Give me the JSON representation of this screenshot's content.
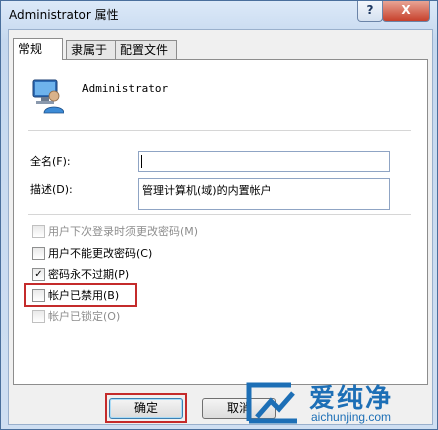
{
  "window": {
    "title": "Administrator 属性",
    "help_label": "?",
    "close_label": "X"
  },
  "tabs": [
    {
      "label": "常规"
    },
    {
      "label": "隶属于"
    },
    {
      "label": "配置文件"
    }
  ],
  "general": {
    "username": "Administrator",
    "fullname_label": "全名(F):",
    "fullname_value": "",
    "description_label": "描述(D):",
    "description_value": "管理计算机(域)的内置帐户",
    "options": [
      {
        "label": "用户下次登录时须更改密码(M)",
        "checked": false,
        "enabled": false
      },
      {
        "label": "用户不能更改密码(C)",
        "checked": false,
        "enabled": true
      },
      {
        "label": "密码永不过期(P)",
        "checked": true,
        "enabled": true
      },
      {
        "label": "帐户已禁用(B)",
        "checked": false,
        "enabled": true
      },
      {
        "label": "帐户已锁定(O)",
        "checked": false,
        "enabled": false
      }
    ]
  },
  "buttons": {
    "ok": "确定",
    "cancel": "取消"
  },
  "watermark": {
    "name": "爱纯净",
    "url": "aichunjing.com"
  },
  "colors": {
    "highlight": "#c42b2b",
    "watermark": "#1d6fb6"
  }
}
